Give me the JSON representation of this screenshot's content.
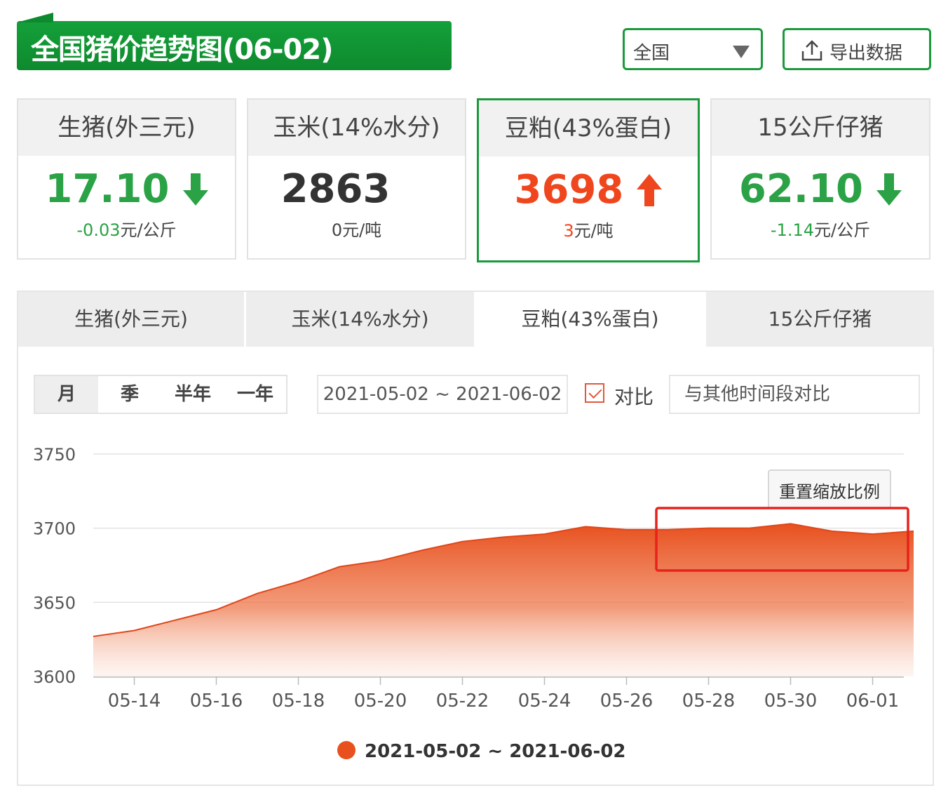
{
  "header": {
    "title": "全国猪价趋势图(06-02)",
    "region_value": "全国",
    "export_label": "导出数据"
  },
  "cards": [
    {
      "title": "生猪(外三元)",
      "value": "17.10",
      "direction": "down",
      "change": "-0.03",
      "unit": "元/公斤"
    },
    {
      "title": "玉米(14%水分)",
      "value": "2863",
      "direction": "none",
      "change": "0",
      "unit": "元/吨"
    },
    {
      "title": "豆粕(43%蛋白)",
      "value": "3698",
      "direction": "up",
      "change": "3",
      "unit": "元/吨"
    },
    {
      "title": "15公斤仔猪",
      "value": "62.10",
      "direction": "down",
      "change": "-1.14",
      "unit": "元/公斤"
    }
  ],
  "tabs": [
    {
      "label": "生猪(外三元)"
    },
    {
      "label": "玉米(14%水分)"
    },
    {
      "label": "豆粕(43%蛋白)"
    },
    {
      "label": "15公斤仔猪"
    }
  ],
  "active_tab": 2,
  "controls": {
    "periods": [
      "月",
      "季",
      "半年",
      "一年"
    ],
    "active_period": "月",
    "date_range": "2021-05-02 ~ 2021-06-02",
    "compare_label": "对比",
    "compare_checked": true,
    "compare_placeholder": "与其他时间段对比",
    "reset_zoom_label": "重置缩放比例"
  },
  "colors": {
    "brand_green": "#1a9a3b",
    "up_red": "#f0461e",
    "down_green": "#2aa245",
    "series_orange": "#e8501e",
    "highlight_box": "#e8221c"
  },
  "chart_data": {
    "type": "area",
    "ylim": [
      3600,
      3750
    ],
    "yticks": [
      3750,
      3700,
      3650,
      3600
    ],
    "xticks": [
      "05-14",
      "05-16",
      "05-18",
      "05-20",
      "05-22",
      "05-24",
      "05-26",
      "05-28",
      "05-30",
      "06-01"
    ],
    "series": [
      {
        "name": "2021-05-02 ~ 2021-06-02",
        "x": [
          "05-13",
          "05-14",
          "05-15",
          "05-16",
          "05-17",
          "05-18",
          "05-19",
          "05-20",
          "05-21",
          "05-22",
          "05-23",
          "05-24",
          "05-25",
          "05-26",
          "05-27",
          "05-28",
          "05-29",
          "05-30",
          "05-31",
          "06-01",
          "06-02"
        ],
        "values": [
          3627,
          3631,
          3638,
          3645,
          3656,
          3664,
          3674,
          3678,
          3685,
          3691,
          3694,
          3696,
          3701,
          3699,
          3699,
          3700,
          3700,
          3703,
          3698,
          3696,
          3698
        ]
      }
    ],
    "legend": "bottom-center",
    "grid": true
  }
}
